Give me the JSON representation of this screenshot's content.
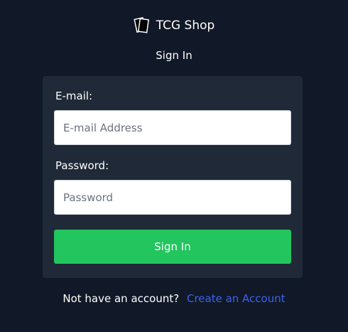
{
  "brand": {
    "logo_icon": "playing-cards-icon",
    "name": "TCG Shop"
  },
  "page": {
    "heading": "Sign In"
  },
  "form": {
    "email": {
      "label": "E-mail:",
      "placeholder": "E-mail Address",
      "value": ""
    },
    "password": {
      "label": "Password:",
      "placeholder": "Password",
      "value": ""
    },
    "submit_label": "Sign In"
  },
  "footer": {
    "prompt": "Not have an account?",
    "link_label": "Create an Account"
  },
  "colors": {
    "background": "#111827",
    "card": "#1f2937",
    "accent": "#22c55e",
    "link": "#3b63e8"
  }
}
